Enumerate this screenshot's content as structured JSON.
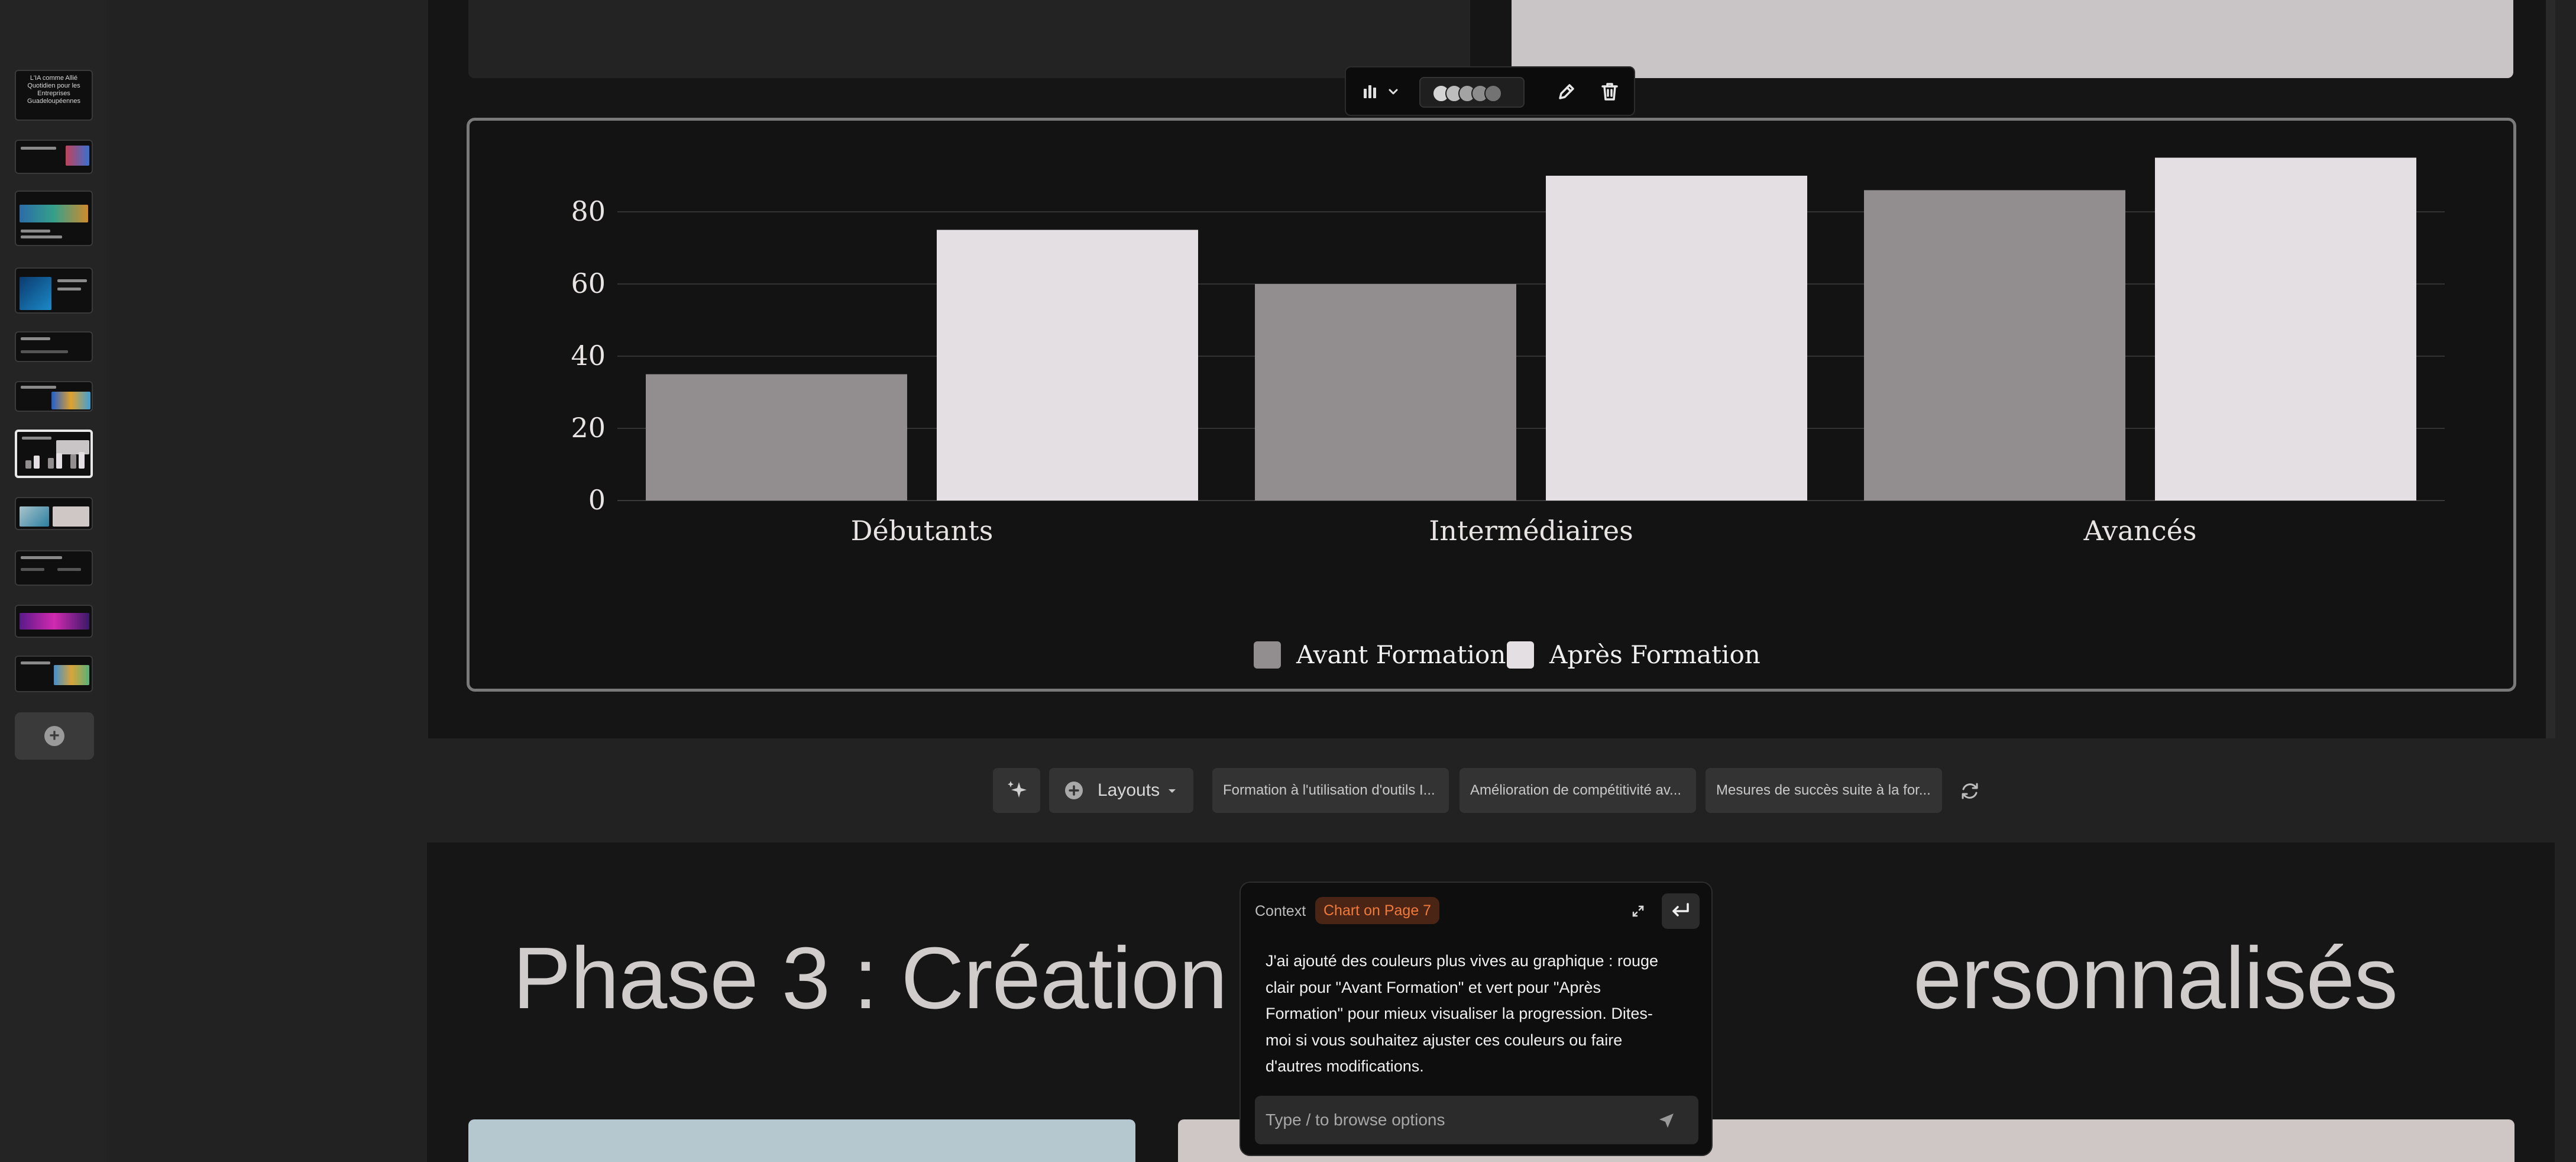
{
  "sidebar": {
    "first_slide_title": "L'IA comme Allié Quotidien pour les Entreprises Guadeloupéennes",
    "add_slide_icon": "plus-circle-icon",
    "active_slide": 7
  },
  "chart_toolbar": {
    "chart_type_icon": "bar-chart-icon",
    "dropdown_icon": "chevron-down-icon",
    "palette": [
      "#d4d4d4",
      "#bdbdbd",
      "#a3a3a3",
      "#8c8c8c",
      "#737373"
    ],
    "edit_icon": "pencil-icon",
    "delete_icon": "trash-icon"
  },
  "chart_data": {
    "type": "bar",
    "categories": [
      "Débutants",
      "Intermédiaires",
      "Avancés"
    ],
    "series": [
      {
        "name": "Avant Formation",
        "values": [
          35,
          60,
          86
        ],
        "color": "#928e90"
      },
      {
        "name": "Après Formation",
        "values": [
          75,
          90,
          95
        ],
        "color": "#e4dfe2"
      }
    ],
    "y_ticks": [
      "0",
      "20",
      "40",
      "60",
      "80"
    ],
    "ylim": [
      0,
      95
    ],
    "grid": true,
    "legend_position": "bottom-center"
  },
  "layout_bar": {
    "sparkle_icon": "sparkle-icon",
    "layouts_label": "Layouts",
    "suggestions": [
      "Formation à l'utilisation d'outils I...",
      "Amélioration de compétitivité av...",
      "Mesures de succès suite à la for..."
    ],
    "refresh_icon": "refresh-icon"
  },
  "next_slide": {
    "title_left": "Phase 3 : Création ",
    "title_right": "ersonnalisés"
  },
  "chat": {
    "context_label": "Context",
    "context_chip": "Chart on Page 7",
    "message": "J'ai ajouté des couleurs plus vives au graphique : rouge clair pour \"Avant Formation\" et vert pour \"Après Formation\" pour mieux visualiser la progression. Dites-moi si vous souhaitez ajuster ces couleurs ou faire d'autres modifications.",
    "input_placeholder": "Type / to browse options"
  }
}
